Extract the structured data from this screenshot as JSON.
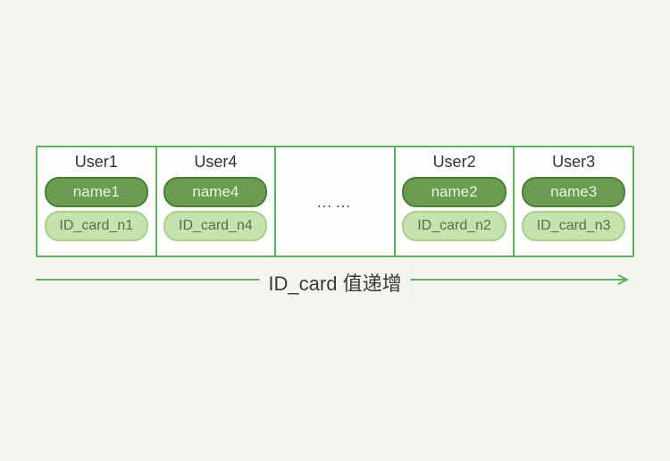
{
  "cells": [
    {
      "user": "User1",
      "name": "name1",
      "id": "ID_card_n1"
    },
    {
      "user": "User4",
      "name": "name4",
      "id": "ID_card_n4"
    },
    {
      "ellipsis": "……"
    },
    {
      "user": "User2",
      "name": "name2",
      "id": "ID_card_n2"
    },
    {
      "user": "User3",
      "name": "name3",
      "id": "ID_card_n3"
    }
  ],
  "arrow_label": "ID_card 值递增"
}
